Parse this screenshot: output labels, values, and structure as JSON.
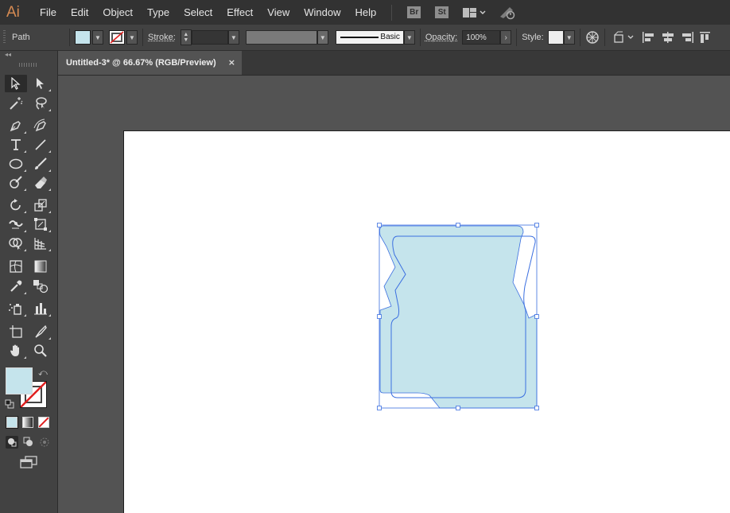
{
  "app": {
    "logo": "Ai"
  },
  "menu": [
    "File",
    "Edit",
    "Object",
    "Type",
    "Select",
    "Effect",
    "View",
    "Window",
    "Help"
  ],
  "bridge_badges": [
    "Br",
    "St"
  ],
  "control": {
    "selection": "Path",
    "stroke_label": "Stroke:",
    "brush_style": "Basic",
    "opacity_label": "Opacity:",
    "opacity_value": "100%",
    "style_label": "Style:"
  },
  "document": {
    "tab_title": "Untitled-3* @ 66.67% (RGB/Preview)",
    "close_glyph": "×"
  },
  "colors": {
    "fill": "#c5e4ec",
    "shape_stroke": "#3b6fe0",
    "stroke_none": "#e02020"
  },
  "tools": [
    "selection-tool",
    "direct-selection-tool",
    "magic-wand-tool",
    "lasso-tool",
    "pen-tool",
    "curvature-tool",
    "type-tool",
    "line-segment-tool",
    "ellipse-tool",
    "paintbrush-tool",
    "shaper-tool",
    "eraser-tool",
    "rotate-tool",
    "scale-tool",
    "width-tool",
    "free-transform-tool",
    "shape-builder-tool",
    "perspective-grid-tool",
    "mesh-tool",
    "gradient-tool",
    "eyedropper-tool",
    "blend-tool",
    "symbol-sprayer-tool",
    "column-graph-tool",
    "artboard-tool",
    "slice-tool",
    "hand-tool",
    "zoom-tool"
  ]
}
